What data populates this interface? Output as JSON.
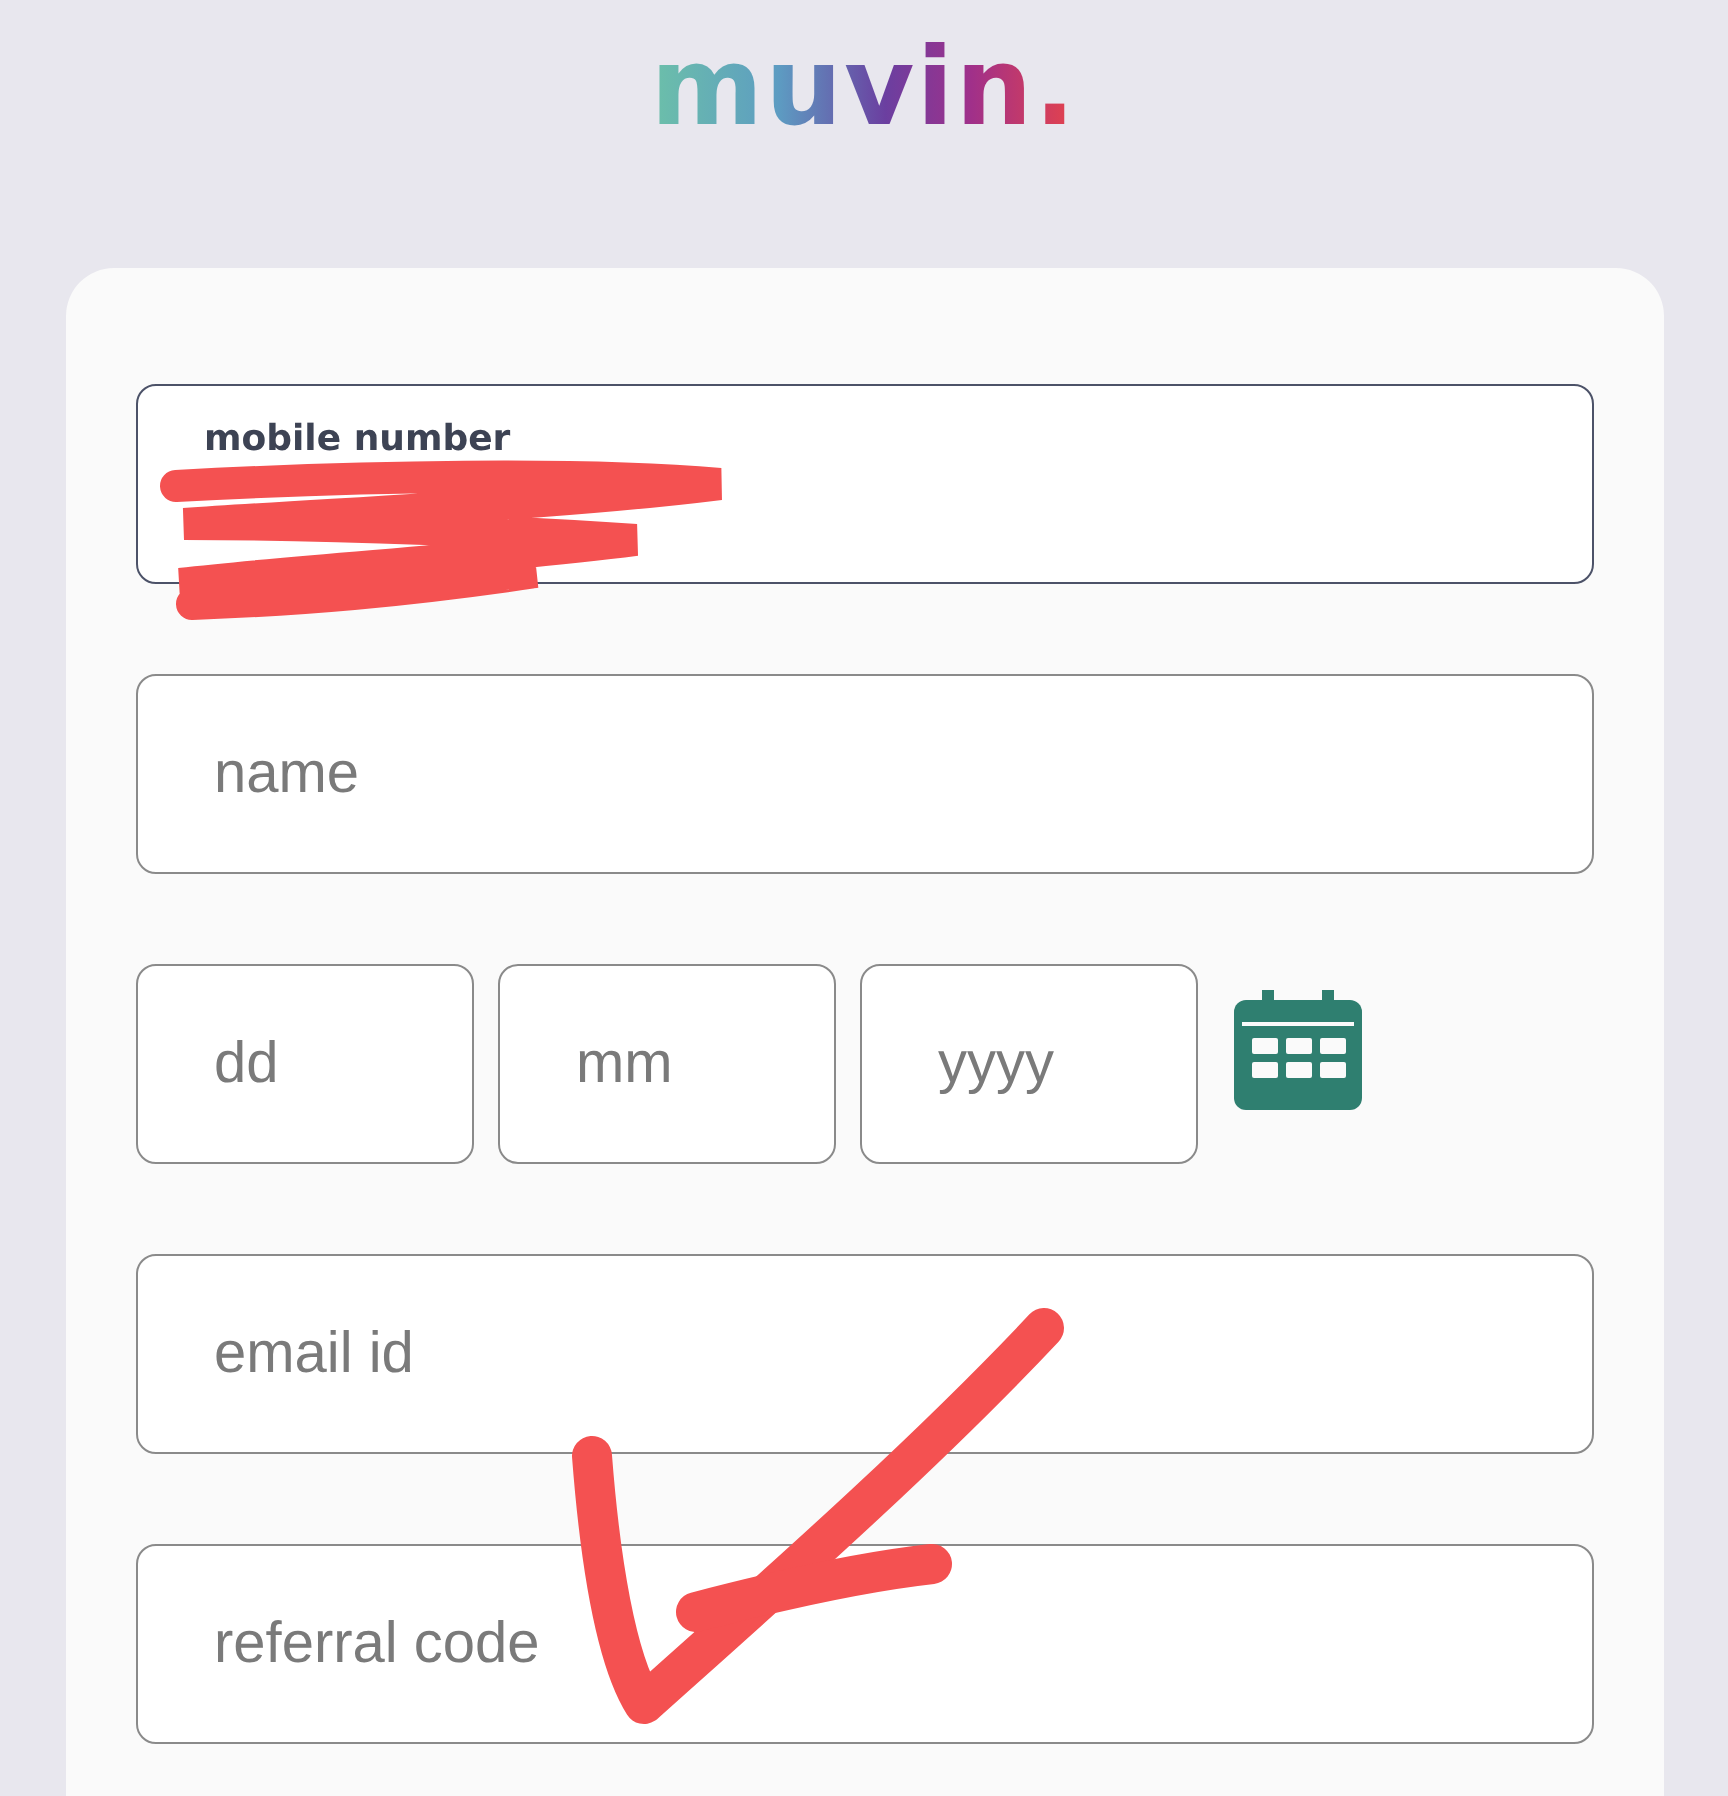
{
  "logo": {
    "text": "muvin."
  },
  "form": {
    "mobile": {
      "label": "mobile number",
      "focused": true
    },
    "name": {
      "placeholder": "name"
    },
    "date_of_birth": [
      {
        "placeholder": "dd"
      },
      {
        "placeholder": "mm"
      },
      {
        "placeholder": "yyyy"
      }
    ],
    "email": {
      "placeholder": "email id"
    },
    "referral": {
      "placeholder": "referral code"
    }
  },
  "annotations": {
    "redaction": true,
    "checkmark": true
  }
}
